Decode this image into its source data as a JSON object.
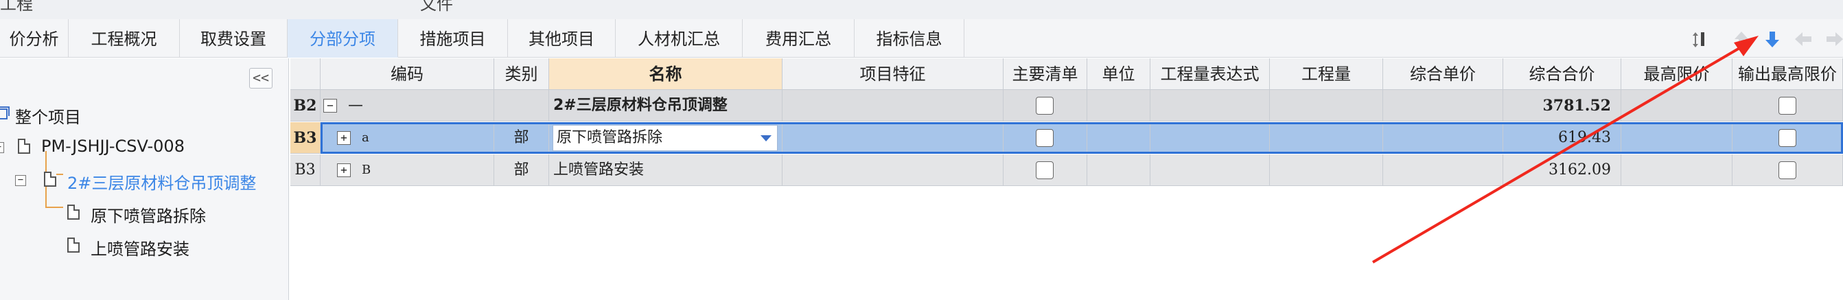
{
  "top_menu": {
    "item_left": "工程",
    "item_mid": "文件"
  },
  "tabs": [
    {
      "label": "价分析"
    },
    {
      "label": "工程概况"
    },
    {
      "label": "取费设置"
    },
    {
      "label": "分部分项",
      "active": true
    },
    {
      "label": "措施项目"
    },
    {
      "label": "其他项目"
    },
    {
      "label": "人材机汇总"
    },
    {
      "label": "费用汇总"
    },
    {
      "label": "指标信息"
    }
  ],
  "toolbar_icons": [
    "sort-icon",
    "move-up-icon",
    "move-down-icon",
    "move-left-icon",
    "move-right-icon"
  ],
  "tree": {
    "collapse_label": "<<",
    "nodes": [
      {
        "label": "整个项目"
      },
      {
        "label": "PM-JSHJJ-CSV-008"
      },
      {
        "label": "2#三层原材料仓吊顶调整",
        "selected": true
      },
      {
        "label": "原下喷管路拆除"
      },
      {
        "label": "上喷管路安装"
      }
    ]
  },
  "grid": {
    "columns": [
      "编码",
      "类别",
      "名称",
      "项目特征",
      "主要清单",
      "单位",
      "工程量表达式",
      "工程量",
      "综合单价",
      "综合合价",
      "最高限价",
      "输出最高限价"
    ],
    "rows": [
      {
        "rownum": "B2",
        "expander": "−",
        "code": "—",
        "type": "",
        "name": "2#三层原材料仓吊顶调整",
        "total": "3781.52"
      },
      {
        "rownum": "B3",
        "expander": "+",
        "code": "a",
        "type": "部",
        "name": "原下喷管路拆除",
        "total": "619.43"
      },
      {
        "rownum": "B3",
        "expander": "+",
        "code": "B",
        "type": "部",
        "name": "上喷管路安装",
        "total": "3162.09"
      }
    ]
  },
  "colors": {
    "accent": "#3b86e6",
    "selection": "#a7c5ea",
    "arrow": "#f0281e"
  }
}
